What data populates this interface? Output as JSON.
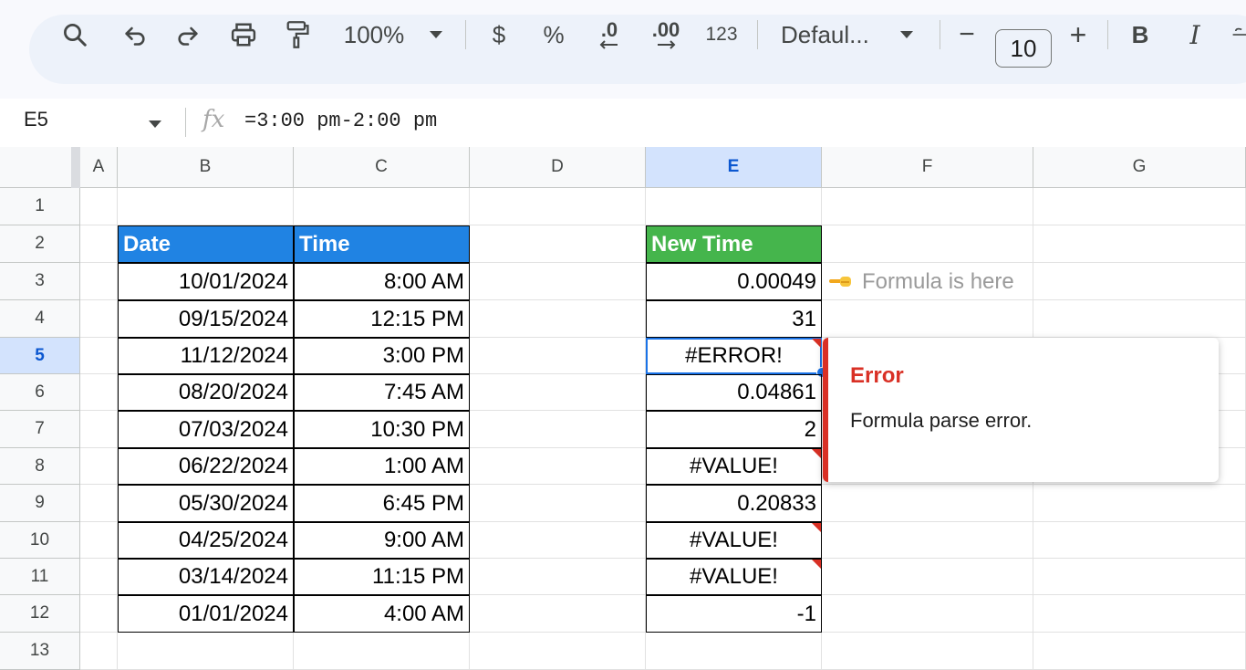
{
  "toolbar": {
    "zoom": "100%",
    "currency": "$",
    "percent": "%",
    "decrease_decimals": ".0",
    "increase_decimals": ".00",
    "number_format": "123",
    "font": "Defaul...",
    "minus": "−",
    "font_size": "10",
    "plus": "+",
    "bold": "B",
    "italic": "I"
  },
  "formula_bar": {
    "cell_ref": "E5",
    "fx": "fx",
    "formula": "=3:00 pm-2:00 pm"
  },
  "columns": [
    "A",
    "B",
    "C",
    "D",
    "E",
    "F",
    "G"
  ],
  "rows": [
    "1",
    "2",
    "3",
    "4",
    "5",
    "6",
    "7",
    "8",
    "9",
    "10",
    "11",
    "12",
    "13"
  ],
  "table_left": {
    "headers": [
      "Date",
      "Time"
    ],
    "header_color": "#2083e3",
    "rows": [
      [
        "10/01/2024",
        "8:00 AM"
      ],
      [
        "09/15/2024",
        "12:15 PM"
      ],
      [
        "11/12/2024",
        "3:00 PM"
      ],
      [
        "08/20/2024",
        "7:45 AM"
      ],
      [
        "07/03/2024",
        "10:30 PM"
      ],
      [
        "06/22/2024",
        "1:00 AM"
      ],
      [
        "05/30/2024",
        "6:45 PM"
      ],
      [
        "04/25/2024",
        "9:00 AM"
      ],
      [
        "03/14/2024",
        "11:15 PM"
      ],
      [
        "01/01/2024",
        "4:00 AM"
      ]
    ]
  },
  "table_right": {
    "header": "New Time",
    "header_color": "#45b54c",
    "values": [
      "0.00049",
      "31",
      "#ERROR!",
      "0.04861",
      "2",
      "#VALUE!",
      "0.20833",
      "#VALUE!",
      "#VALUE!",
      "-1"
    ]
  },
  "annotation": {
    "icon": "pointing-hand-icon",
    "text": "Formula is here"
  },
  "error_popup": {
    "title": "Error",
    "message": "Formula parse error."
  }
}
